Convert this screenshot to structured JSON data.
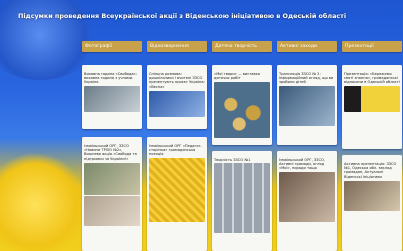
{
  "page": {
    "title": "Підсумки проведення Всеукраїнської акції з Віденською ініціативою в Одеській області"
  },
  "columns": [
    {
      "label": "Фотографії"
    },
    {
      "label": "Відеозвернення"
    },
    {
      "label": "Дитяча творчість"
    },
    {
      "label": "Активні заходи"
    },
    {
      "label": "Презентації"
    }
  ],
  "cards": {
    "c1a": {
      "text": "Виховна година «Свобода»: виховна година з учнями. Україна"
    },
    "c1b": {
      "text": "Ізмаїльський ОРГ, ЗЗСО «Новини ТРІЗО №2», Вишнева акція «Свобода та підтримки за України!»"
    },
    "c2a": {
      "text": "Спільна розмова: дошкільники і вчителі ЗЗСО презентують проєкт Україна: «Весна»"
    },
    "c2b": {
      "text": "Ізмаїльський ОРГ «Педагог-сторінка» громадянська позиція"
    },
    "c3a": {
      "text": "«Мої твори» — виставка дитячих робіт"
    },
    "c3b": {
      "text": "Творчість ЗЗСО №1"
    },
    "c4a": {
      "text": "Трансляція ЗЗСО № 2: інформаційний огляд, що ви зробили дітей"
    },
    "c4b": {
      "text": "Ізмаїльський ОРГ, ЗЗСО, Активні громади, огляд «Мої», поради тощо"
    },
    "c5a": {
      "text": "Презентація: «Бережемо святі знання», громадянські відносини в Одеській області"
    },
    "c5b": {
      "text": "Активна презентація: ЗЗСО №1, Одеська обл. заклад громадян, Актуальні Віденські ініціативи"
    }
  }
}
